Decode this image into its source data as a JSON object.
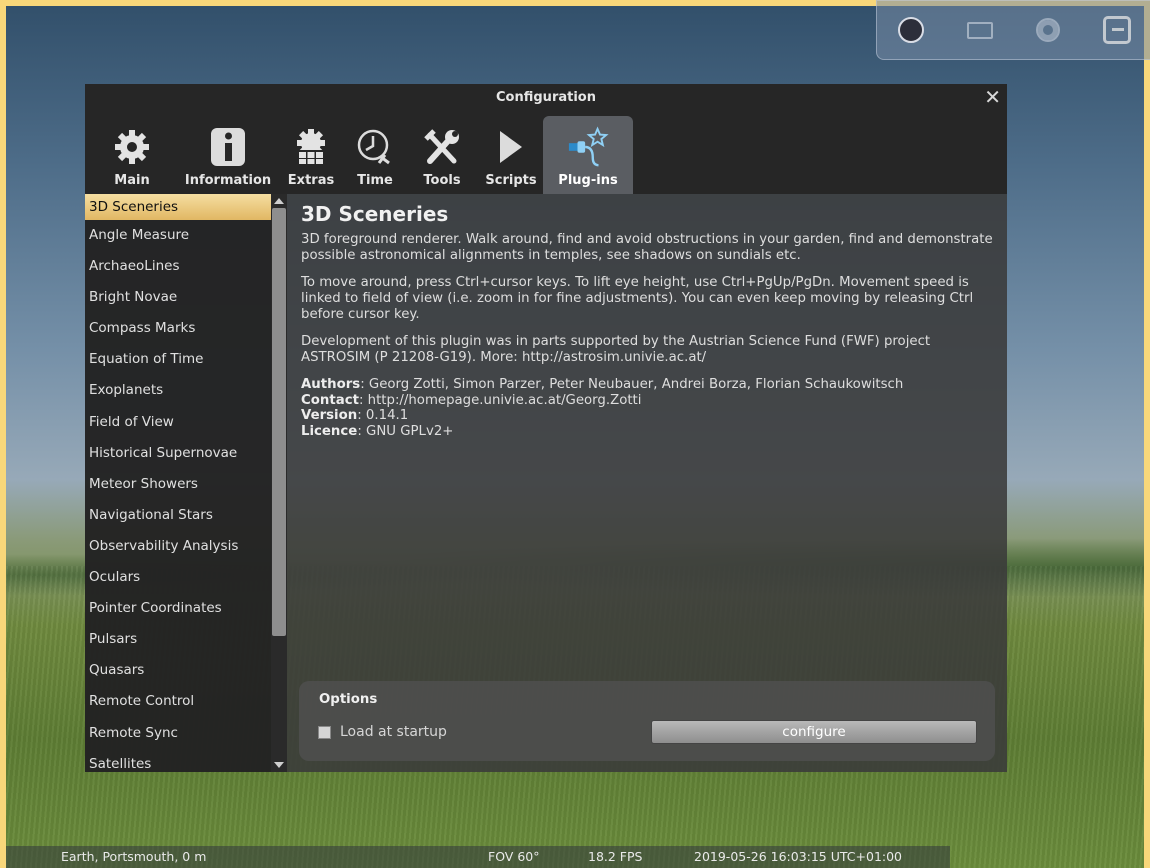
{
  "window": {
    "title": "Configuration",
    "close": "✕"
  },
  "tabs": [
    {
      "label": "Main",
      "icon": "gear-icon"
    },
    {
      "label": "Information",
      "icon": "info-icon"
    },
    {
      "label": "Extras",
      "icon": "extras-gear-icon"
    },
    {
      "label": "Time",
      "icon": "clock-icon"
    },
    {
      "label": "Tools",
      "icon": "tools-icon"
    },
    {
      "label": "Scripts",
      "icon": "play-icon"
    },
    {
      "label": "Plug-ins",
      "icon": "plugin-icon",
      "active": true
    }
  ],
  "plugins": [
    "3D Sceneries",
    "Angle Measure",
    "ArchaeoLines",
    "Bright Novae",
    "Compass Marks",
    "Equation of Time",
    "Exoplanets",
    "Field of View",
    "Historical Supernovae",
    "Meteor Showers",
    "Navigational Stars",
    "Observability Analysis",
    "Oculars",
    "Pointer Coordinates",
    "Pulsars",
    "Quasars",
    "Remote Control",
    "Remote Sync",
    "Satellites"
  ],
  "selected_plugin": "3D Sceneries",
  "details": {
    "title": "3D Sceneries",
    "p1": "3D foreground renderer. Walk around, find and avoid obstructions in your garden, find and demonstrate possible astronomical alignments in temples, see shadows on sundials etc.",
    "p2": "To move around, press Ctrl+cursor keys. To lift eye height, use Ctrl+PgUp/PgDn. Movement speed is linked to field of view (i.e. zoom in for fine adjustments). You can even keep moving by releasing Ctrl before cursor key.",
    "p3": "Development of this plugin was in parts supported by the Austrian Science Fund (FWF) project ASTROSIM (P 21208-G19). More: http://astrosim.univie.ac.at/",
    "authors_label": "Authors",
    "authors": ": Georg Zotti, Simon Parzer, Peter Neubauer, Andrei Borza, Florian Schaukowitsch",
    "contact_label": "Contact",
    "contact": ": http://homepage.univie.ac.at/Georg.Zotti",
    "version_label": "Version",
    "version": ": 0.14.1",
    "licence_label": "Licence",
    "licence": ": GNU GPLv2+"
  },
  "options": {
    "title": "Options",
    "load_at_startup_label": "Load at startup",
    "load_at_startup_checked": false,
    "configure_label": "configure"
  },
  "status": {
    "location": "Earth, Portsmouth, 0 m",
    "fov": "FOV 60°",
    "fps": "18.2 FPS",
    "datetime": "2019-05-26 16:03:15 UTC+01:00"
  },
  "colors": {
    "selection": "#e1b763",
    "active_tab": "#5a5d62",
    "frame": "#f8d77a"
  }
}
